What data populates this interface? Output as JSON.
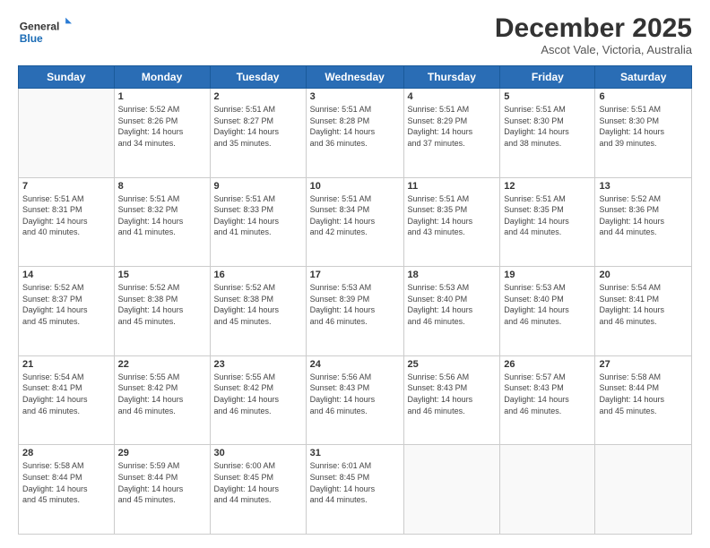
{
  "logo": {
    "line1": "General",
    "line2": "Blue"
  },
  "title": "December 2025",
  "location": "Ascot Vale, Victoria, Australia",
  "headers": [
    "Sunday",
    "Monday",
    "Tuesday",
    "Wednesday",
    "Thursday",
    "Friday",
    "Saturday"
  ],
  "weeks": [
    [
      {
        "day": "",
        "info": ""
      },
      {
        "day": "1",
        "info": "Sunrise: 5:52 AM\nSunset: 8:26 PM\nDaylight: 14 hours\nand 34 minutes."
      },
      {
        "day": "2",
        "info": "Sunrise: 5:51 AM\nSunset: 8:27 PM\nDaylight: 14 hours\nand 35 minutes."
      },
      {
        "day": "3",
        "info": "Sunrise: 5:51 AM\nSunset: 8:28 PM\nDaylight: 14 hours\nand 36 minutes."
      },
      {
        "day": "4",
        "info": "Sunrise: 5:51 AM\nSunset: 8:29 PM\nDaylight: 14 hours\nand 37 minutes."
      },
      {
        "day": "5",
        "info": "Sunrise: 5:51 AM\nSunset: 8:30 PM\nDaylight: 14 hours\nand 38 minutes."
      },
      {
        "day": "6",
        "info": "Sunrise: 5:51 AM\nSunset: 8:30 PM\nDaylight: 14 hours\nand 39 minutes."
      }
    ],
    [
      {
        "day": "7",
        "info": "Sunrise: 5:51 AM\nSunset: 8:31 PM\nDaylight: 14 hours\nand 40 minutes."
      },
      {
        "day": "8",
        "info": "Sunrise: 5:51 AM\nSunset: 8:32 PM\nDaylight: 14 hours\nand 41 minutes."
      },
      {
        "day": "9",
        "info": "Sunrise: 5:51 AM\nSunset: 8:33 PM\nDaylight: 14 hours\nand 41 minutes."
      },
      {
        "day": "10",
        "info": "Sunrise: 5:51 AM\nSunset: 8:34 PM\nDaylight: 14 hours\nand 42 minutes."
      },
      {
        "day": "11",
        "info": "Sunrise: 5:51 AM\nSunset: 8:35 PM\nDaylight: 14 hours\nand 43 minutes."
      },
      {
        "day": "12",
        "info": "Sunrise: 5:51 AM\nSunset: 8:35 PM\nDaylight: 14 hours\nand 44 minutes."
      },
      {
        "day": "13",
        "info": "Sunrise: 5:52 AM\nSunset: 8:36 PM\nDaylight: 14 hours\nand 44 minutes."
      }
    ],
    [
      {
        "day": "14",
        "info": "Sunrise: 5:52 AM\nSunset: 8:37 PM\nDaylight: 14 hours\nand 45 minutes."
      },
      {
        "day": "15",
        "info": "Sunrise: 5:52 AM\nSunset: 8:38 PM\nDaylight: 14 hours\nand 45 minutes."
      },
      {
        "day": "16",
        "info": "Sunrise: 5:52 AM\nSunset: 8:38 PM\nDaylight: 14 hours\nand 45 minutes."
      },
      {
        "day": "17",
        "info": "Sunrise: 5:53 AM\nSunset: 8:39 PM\nDaylight: 14 hours\nand 46 minutes."
      },
      {
        "day": "18",
        "info": "Sunrise: 5:53 AM\nSunset: 8:40 PM\nDaylight: 14 hours\nand 46 minutes."
      },
      {
        "day": "19",
        "info": "Sunrise: 5:53 AM\nSunset: 8:40 PM\nDaylight: 14 hours\nand 46 minutes."
      },
      {
        "day": "20",
        "info": "Sunrise: 5:54 AM\nSunset: 8:41 PM\nDaylight: 14 hours\nand 46 minutes."
      }
    ],
    [
      {
        "day": "21",
        "info": "Sunrise: 5:54 AM\nSunset: 8:41 PM\nDaylight: 14 hours\nand 46 minutes."
      },
      {
        "day": "22",
        "info": "Sunrise: 5:55 AM\nSunset: 8:42 PM\nDaylight: 14 hours\nand 46 minutes."
      },
      {
        "day": "23",
        "info": "Sunrise: 5:55 AM\nSunset: 8:42 PM\nDaylight: 14 hours\nand 46 minutes."
      },
      {
        "day": "24",
        "info": "Sunrise: 5:56 AM\nSunset: 8:43 PM\nDaylight: 14 hours\nand 46 minutes."
      },
      {
        "day": "25",
        "info": "Sunrise: 5:56 AM\nSunset: 8:43 PM\nDaylight: 14 hours\nand 46 minutes."
      },
      {
        "day": "26",
        "info": "Sunrise: 5:57 AM\nSunset: 8:43 PM\nDaylight: 14 hours\nand 46 minutes."
      },
      {
        "day": "27",
        "info": "Sunrise: 5:58 AM\nSunset: 8:44 PM\nDaylight: 14 hours\nand 45 minutes."
      }
    ],
    [
      {
        "day": "28",
        "info": "Sunrise: 5:58 AM\nSunset: 8:44 PM\nDaylight: 14 hours\nand 45 minutes."
      },
      {
        "day": "29",
        "info": "Sunrise: 5:59 AM\nSunset: 8:44 PM\nDaylight: 14 hours\nand 45 minutes."
      },
      {
        "day": "30",
        "info": "Sunrise: 6:00 AM\nSunset: 8:45 PM\nDaylight: 14 hours\nand 44 minutes."
      },
      {
        "day": "31",
        "info": "Sunrise: 6:01 AM\nSunset: 8:45 PM\nDaylight: 14 hours\nand 44 minutes."
      },
      {
        "day": "",
        "info": ""
      },
      {
        "day": "",
        "info": ""
      },
      {
        "day": "",
        "info": ""
      }
    ]
  ]
}
